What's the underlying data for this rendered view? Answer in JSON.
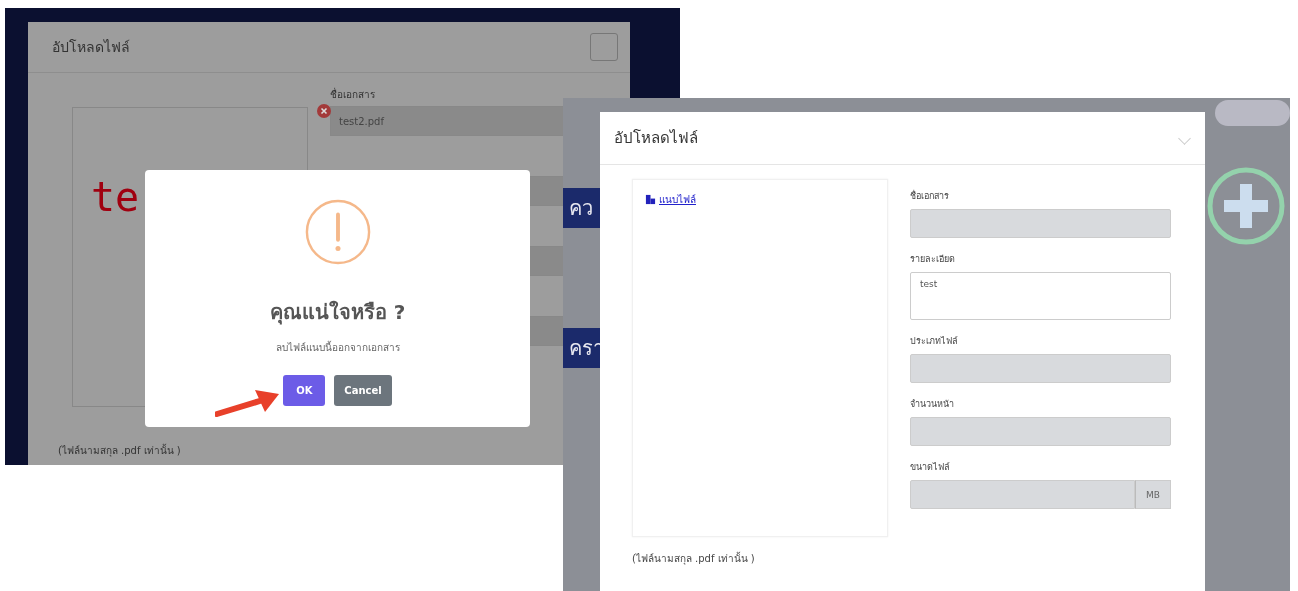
{
  "left_screenshot": {
    "modal": {
      "title": "อัปโหลดไฟล์",
      "preview_text": "te",
      "fields": [
        {
          "label": "ชื่อเอกสาร",
          "value": "test2.pdf"
        }
      ],
      "note": "(ไฟล์นามสกุล .pdf เท่านั้น )"
    },
    "alert": {
      "title": "คุณแน่ใจหรือ ?",
      "message": "ลบไฟล์แนบนี้ออกจากเอกสาร",
      "buttons": [
        {
          "label": "OK",
          "kind": "confirm"
        },
        {
          "label": "Cancel",
          "kind": "cancel"
        }
      ]
    }
  },
  "right_screenshot": {
    "background_texts": [
      "คว",
      "ครา"
    ],
    "modal": {
      "title": "อัปโหลดไฟล์",
      "attach_link": "แนบไฟล์",
      "fields": [
        {
          "label": "ชื่อเอกสาร",
          "kind": "input"
        },
        {
          "label": "รายละเอียด",
          "kind": "textarea",
          "value": "test"
        },
        {
          "label": "ประเภทไฟล์",
          "kind": "input"
        },
        {
          "label": "จำนวนหน้า",
          "kind": "input"
        },
        {
          "label": "ขนาดไฟล์",
          "kind": "addon",
          "addon": "MB"
        }
      ],
      "note": "(ไฟล์นามสกุล .pdf เท่านั้น )"
    }
  }
}
